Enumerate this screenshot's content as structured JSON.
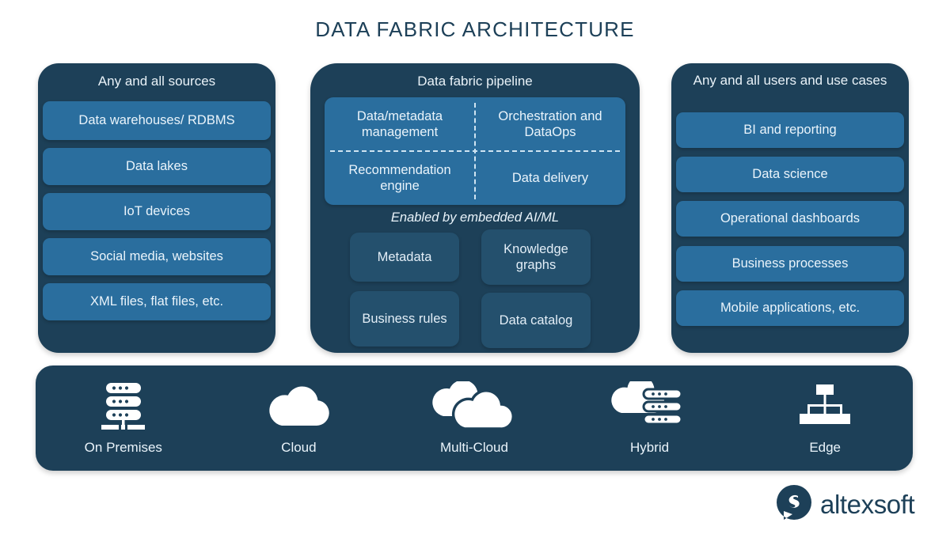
{
  "title": "DATA FABRIC ARCHITECTURE",
  "sources": {
    "heading": "Any and all sources",
    "items": [
      "Data warehouses/ RDBMS",
      "Data lakes",
      "IoT devices",
      "Social media, websites",
      "XML files, flat files, etc."
    ]
  },
  "pipeline": {
    "heading": "Data fabric pipeline",
    "grid": [
      "Data/metadata management",
      "Orchestration and DataOps",
      "Recommendation engine",
      "Data delivery"
    ],
    "enabled_note": "Enabled by embedded AI/ML",
    "ai_boxes": [
      "Metadata",
      "Knowledge graphs",
      "Business rules",
      "Data catalog"
    ]
  },
  "users": {
    "heading": "Any and all users and use cases",
    "items": [
      "BI and reporting",
      "Data science",
      "Operational dashboards",
      "Business processes",
      "Mobile applications, etc."
    ]
  },
  "deployment": {
    "items": [
      {
        "label": "On Premises",
        "icon": "server-rack-icon"
      },
      {
        "label": "Cloud",
        "icon": "cloud-icon"
      },
      {
        "label": "Multi-Cloud",
        "icon": "multi-cloud-icon"
      },
      {
        "label": "Hybrid",
        "icon": "cloud-server-icon"
      },
      {
        "label": "Edge",
        "icon": "hierarchy-nodes-icon"
      }
    ]
  },
  "brand": {
    "name": "altexsoft",
    "logo_icon": "altexsoft-bubble-logo"
  },
  "colors": {
    "navy": "#1d4058",
    "pill_blue": "#2a6e9e",
    "ai_box": "#24506d",
    "text_light": "#eaf4fb",
    "background": "#ffffff"
  }
}
